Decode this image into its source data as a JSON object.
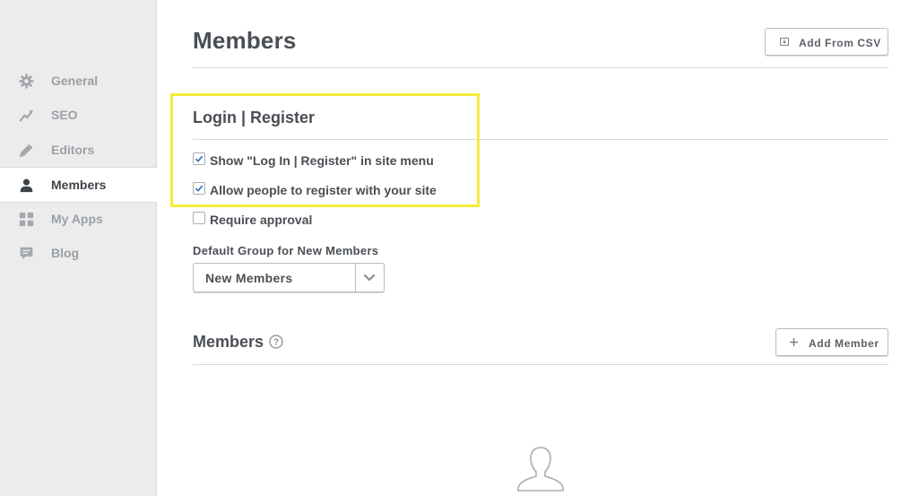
{
  "sidebar": {
    "items": [
      {
        "label": "General",
        "icon": "gear-icon"
      },
      {
        "label": "SEO",
        "icon": "trend-icon"
      },
      {
        "label": "Editors",
        "icon": "pencil-icon"
      },
      {
        "label": "Members",
        "icon": "person-icon",
        "active": true
      },
      {
        "label": "My Apps",
        "icon": "apps-grid-icon"
      },
      {
        "label": "Blog",
        "icon": "comment-icon"
      }
    ]
  },
  "header": {
    "title": "Members",
    "add_csv_label": "Add From CSV"
  },
  "login_register": {
    "title": "Login | Register",
    "options": [
      {
        "label": "Show \"Log In | Register\" in site menu",
        "checked": true
      },
      {
        "label": "Allow people to register with your site",
        "checked": true
      },
      {
        "label": "Require approval",
        "checked": false
      }
    ],
    "default_group_label": "Default Group for New Members",
    "default_group_value": "New Members"
  },
  "members_section": {
    "title": "Members",
    "add_member_label": "Add Member"
  },
  "colors": {
    "highlight": "#f4ec3a",
    "checkmark": "#3b78c2",
    "sidebar_bg": "#ececec"
  }
}
